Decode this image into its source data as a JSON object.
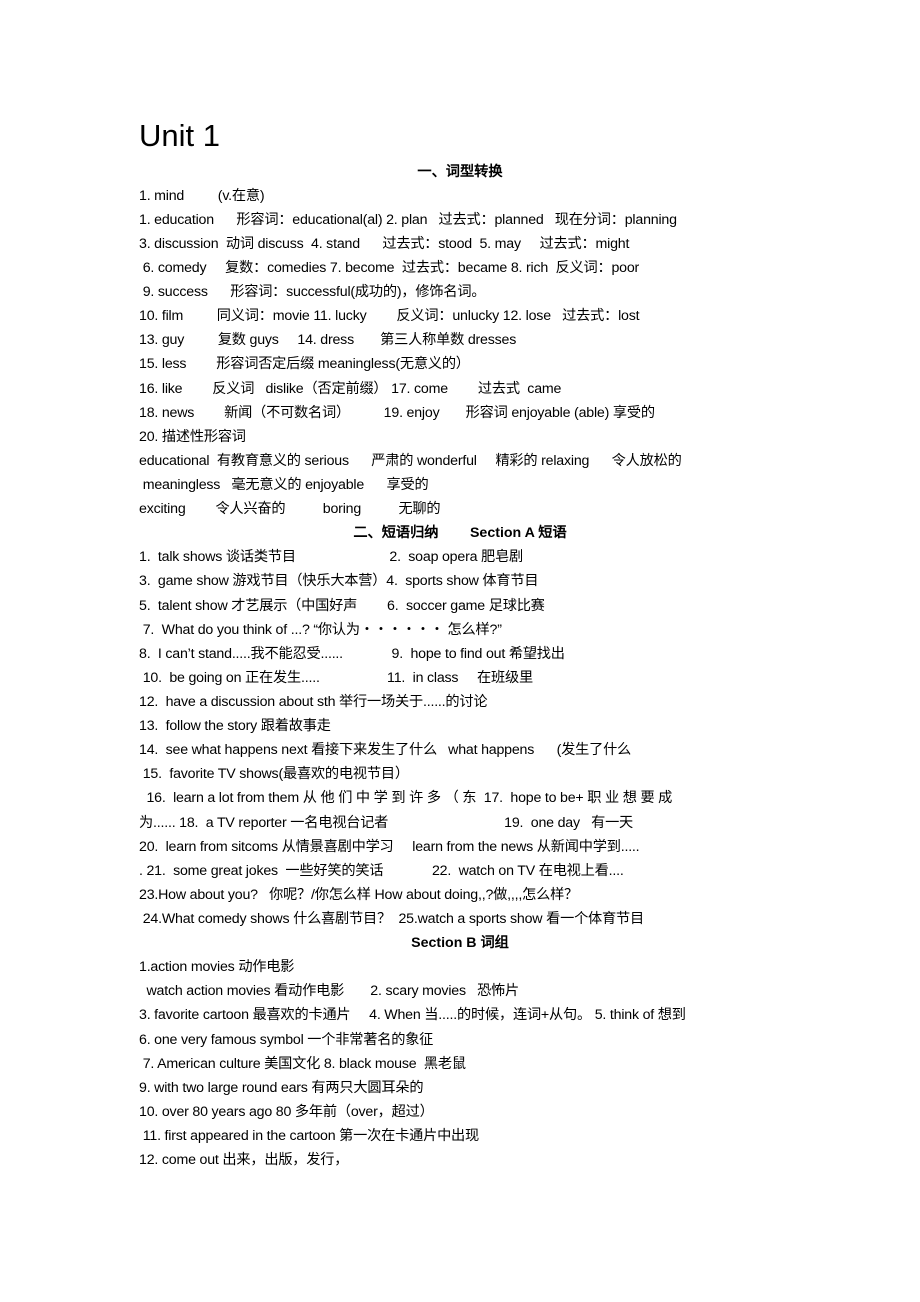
{
  "title": "Unit 1",
  "section1": {
    "heading": "一、词型转换",
    "lines": [
      "1. mind         (v.在意)",
      "1. education      形容词：educational(al) 2. plan   过去式：planned   现在分词：planning",
      "3. discussion  动词 discuss  4. stand      过去式：stood  5. may     过去式：might",
      " 6. comedy     复数：comedies 7. become  过去式：became 8. rich  反义词：poor",
      " 9. success      形容词：successful(成功的)，修饰名词。",
      "10. film         同义词：movie 11. lucky        反义词：unlucky 12. lose   过去式：lost",
      "13. guy         复数 guys     14. dress       第三人称单数 dresses",
      "15. less        形容词否定后缀 meaningless(无意义的）",
      "16. like        反义词   dislike（否定前缀） 17. come        过去式  came",
      "18. news        新闻（不可数名词）         19. enjoy       形容词 enjoyable (able) 享受的",
      "20. 描述性形容词",
      "educational  有教育意义的 serious      严肃的 wonderful     精彩的 relaxing      令人放松的",
      " meaningless   毫无意义的 enjoyable      享受的",
      "exciting        令人兴奋的          boring          无聊的"
    ]
  },
  "section2": {
    "heading": "二、短语归纳        Section A 短语",
    "lines": [
      "1.  talk shows 谈话类节目                         2.  soap opera 肥皂剧",
      "3.  game show 游戏节目（快乐大本营）4.  sports show 体育节目",
      "5.  talent show 才艺展示（中国好声        6.  soccer game 足球比赛",
      " 7.  What do you think of ...? “你认为・・・・・・ 怎么样?”",
      "8.  I can’t stand.....我不能忍受......             9.  hope to find out 希望找出",
      " 10.  be going on 正在发生.....                  11.  in class     在班级里",
      "12.  have a discussion about sth 举行一场关于......的讨论",
      "13.  follow the story 跟着故事走",
      "14.  see what happens next 看接下来发生了什么   what happens      (发生了什么",
      " 15.  favorite TV shows(最喜欢的电视节目）",
      "  16.  learn a lot from them 从 他 们 中 学 到 许 多 （ 东  17.  hope to be+ 职 业 想 要 成",
      "为...... 18.  a TV reporter 一名电视台记者                               19.  one day   有一天",
      "20.  learn from sitcoms 从情景喜剧中学习     learn from the news 从新闻中学到.....",
      ". 21.  some great jokes  一些好笑的笑话             22.  watch on TV 在电视上看....",
      "23.How about you?   你呢？/你怎么样 How about doing,,?做,,,,怎么样？",
      " 24.What comedy shows 什么喜剧节目？  25.watch a sports show 看一个体育节目"
    ]
  },
  "section3": {
    "heading": "Section B 词组",
    "lines": [
      "1.action movies 动作电影",
      "  watch action movies 看动作电影       2. scary movies   恐怖片",
      "3. favorite cartoon 最喜欢的卡通片     4. When 当.....的时候，连词+从句。 5. think of 想到",
      "6. one very famous symbol 一个非常著名的象征",
      " 7. American culture 美国文化 8. black mouse  黑老鼠",
      "9. with two large round ears 有两只大圆耳朵的",
      "10. over 80 years ago 80 多年前（over，超过）",
      " 11. first appeared in the cartoon 第一次在卡通片中出现",
      "12. come out 出来，出版，发行，"
    ]
  }
}
